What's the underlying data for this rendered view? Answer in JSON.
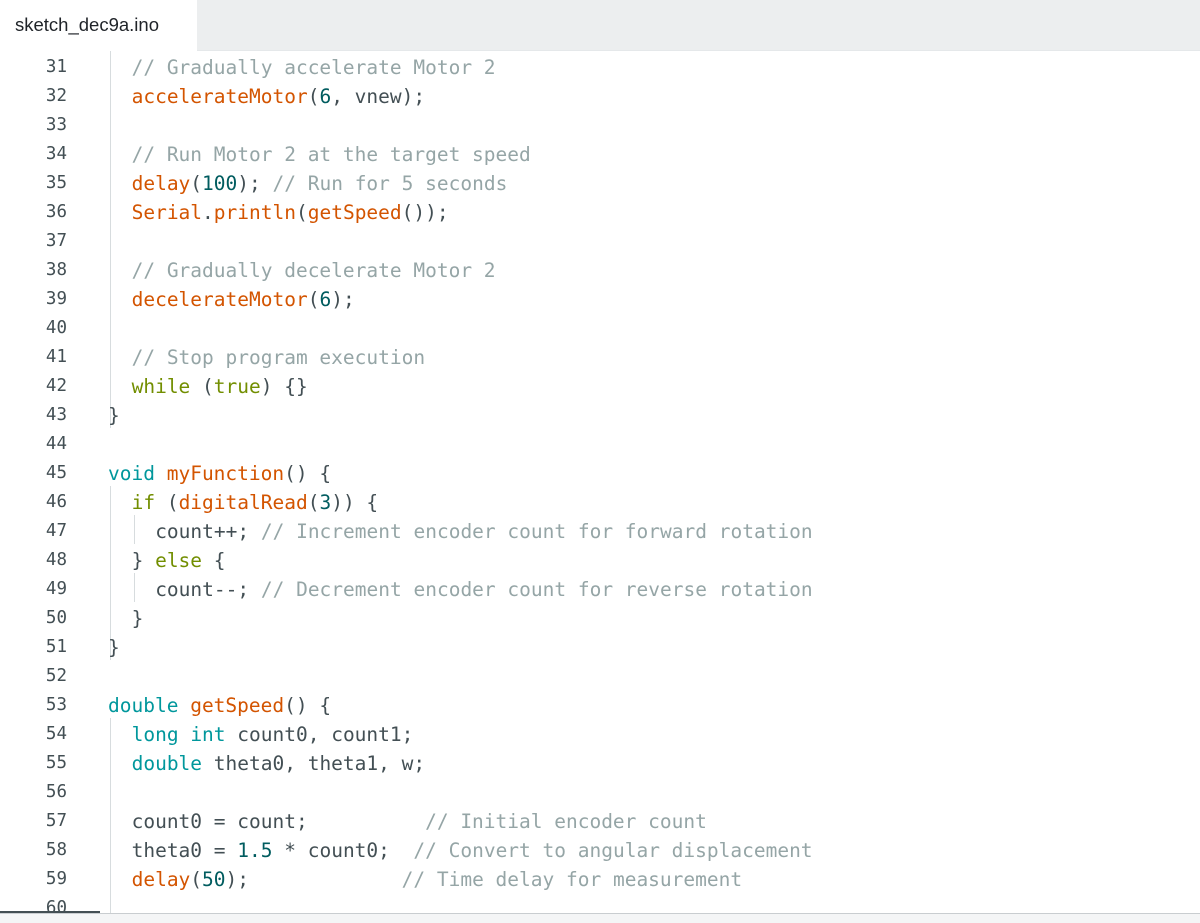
{
  "tab": {
    "file_name": "sketch_dec9a.ino"
  },
  "editor": {
    "lines": [
      {
        "no": "31",
        "indent": 1,
        "tokens": [
          {
            "t": "// Gradually accelerate Motor 2",
            "c": "cm"
          }
        ]
      },
      {
        "no": "32",
        "indent": 1,
        "tokens": [
          {
            "t": "accelerateMotor",
            "c": "fn"
          },
          {
            "t": "(",
            "c": "pl"
          },
          {
            "t": "6",
            "c": "nm"
          },
          {
            "t": ", vnew);",
            "c": "pl"
          }
        ]
      },
      {
        "no": "33",
        "indent": 0,
        "tokens": []
      },
      {
        "no": "34",
        "indent": 1,
        "tokens": [
          {
            "t": "// Run Motor 2 at the target speed",
            "c": "cm"
          }
        ]
      },
      {
        "no": "35",
        "indent": 1,
        "tokens": [
          {
            "t": "delay",
            "c": "fn"
          },
          {
            "t": "(",
            "c": "pl"
          },
          {
            "t": "100",
            "c": "nm"
          },
          {
            "t": "); ",
            "c": "pl"
          },
          {
            "t": "// Run for 5 seconds",
            "c": "cm"
          }
        ]
      },
      {
        "no": "36",
        "indent": 1,
        "tokens": [
          {
            "t": "Serial",
            "c": "fn"
          },
          {
            "t": ".",
            "c": "pl"
          },
          {
            "t": "println",
            "c": "fn"
          },
          {
            "t": "(",
            "c": "pl"
          },
          {
            "t": "getSpeed",
            "c": "fn"
          },
          {
            "t": "());",
            "c": "pl"
          }
        ]
      },
      {
        "no": "37",
        "indent": 0,
        "tokens": []
      },
      {
        "no": "38",
        "indent": 1,
        "tokens": [
          {
            "t": "// Gradually decelerate Motor 2",
            "c": "cm"
          }
        ]
      },
      {
        "no": "39",
        "indent": 1,
        "tokens": [
          {
            "t": "decelerateMotor",
            "c": "fn"
          },
          {
            "t": "(",
            "c": "pl"
          },
          {
            "t": "6",
            "c": "nm"
          },
          {
            "t": ");",
            "c": "pl"
          }
        ]
      },
      {
        "no": "40",
        "indent": 0,
        "tokens": []
      },
      {
        "no": "41",
        "indent": 1,
        "tokens": [
          {
            "t": "// Stop program execution",
            "c": "cm"
          }
        ]
      },
      {
        "no": "42",
        "indent": 1,
        "tokens": [
          {
            "t": "while",
            "c": "kw"
          },
          {
            "t": " (",
            "c": "pl"
          },
          {
            "t": "true",
            "c": "kw"
          },
          {
            "t": ") {}",
            "c": "pl"
          }
        ]
      },
      {
        "no": "43",
        "indent": 0,
        "tokens": [
          {
            "t": "}",
            "c": "pl"
          }
        ]
      },
      {
        "no": "44",
        "indent": 0,
        "tokens": []
      },
      {
        "no": "45",
        "indent": 0,
        "tokens": [
          {
            "t": "void",
            "c": "ty"
          },
          {
            "t": " ",
            "c": "pl"
          },
          {
            "t": "myFunction",
            "c": "fn"
          },
          {
            "t": "() {",
            "c": "pl"
          }
        ]
      },
      {
        "no": "46",
        "indent": 1,
        "tokens": [
          {
            "t": "if",
            "c": "kw"
          },
          {
            "t": " (",
            "c": "pl"
          },
          {
            "t": "digitalRead",
            "c": "fn"
          },
          {
            "t": "(",
            "c": "pl"
          },
          {
            "t": "3",
            "c": "nm"
          },
          {
            "t": ")) {",
            "c": "pl"
          }
        ]
      },
      {
        "no": "47",
        "indent": 2,
        "tokens": [
          {
            "t": "count++; ",
            "c": "pl"
          },
          {
            "t": "// Increment encoder count for forward rotation",
            "c": "cm"
          }
        ]
      },
      {
        "no": "48",
        "indent": 1,
        "tokens": [
          {
            "t": "} ",
            "c": "pl"
          },
          {
            "t": "else",
            "c": "kw"
          },
          {
            "t": " {",
            "c": "pl"
          }
        ]
      },
      {
        "no": "49",
        "indent": 2,
        "tokens": [
          {
            "t": "count--; ",
            "c": "pl"
          },
          {
            "t": "// Decrement encoder count for reverse rotation",
            "c": "cm"
          }
        ]
      },
      {
        "no": "50",
        "indent": 1,
        "tokens": [
          {
            "t": "}",
            "c": "pl"
          }
        ]
      },
      {
        "no": "51",
        "indent": 0,
        "tokens": [
          {
            "t": "}",
            "c": "pl"
          }
        ]
      },
      {
        "no": "52",
        "indent": 0,
        "tokens": []
      },
      {
        "no": "53",
        "indent": 0,
        "tokens": [
          {
            "t": "double",
            "c": "ty"
          },
          {
            "t": " ",
            "c": "pl"
          },
          {
            "t": "getSpeed",
            "c": "fn"
          },
          {
            "t": "() {",
            "c": "pl"
          }
        ]
      },
      {
        "no": "54",
        "indent": 1,
        "tokens": [
          {
            "t": "long",
            "c": "ty"
          },
          {
            "t": " ",
            "c": "pl"
          },
          {
            "t": "int",
            "c": "ty"
          },
          {
            "t": " count0, count1;",
            "c": "pl"
          }
        ]
      },
      {
        "no": "55",
        "indent": 1,
        "tokens": [
          {
            "t": "double",
            "c": "ty"
          },
          {
            "t": " theta0, theta1, w;",
            "c": "pl"
          }
        ]
      },
      {
        "no": "56",
        "indent": 0,
        "tokens": []
      },
      {
        "no": "57",
        "indent": 1,
        "tokens": [
          {
            "t": "count0 = count;          ",
            "c": "pl"
          },
          {
            "t": "// Initial encoder count",
            "c": "cm"
          }
        ]
      },
      {
        "no": "58",
        "indent": 1,
        "tokens": [
          {
            "t": "theta0 = ",
            "c": "pl"
          },
          {
            "t": "1.5",
            "c": "nm"
          },
          {
            "t": " * count0;  ",
            "c": "pl"
          },
          {
            "t": "// Convert to angular displacement",
            "c": "cm"
          }
        ]
      },
      {
        "no": "59",
        "indent": 1,
        "tokens": [
          {
            "t": "delay",
            "c": "fn"
          },
          {
            "t": "(",
            "c": "pl"
          },
          {
            "t": "50",
            "c": "nm"
          },
          {
            "t": ");             ",
            "c": "pl"
          },
          {
            "t": "// Time delay for measurement",
            "c": "cm"
          }
        ]
      },
      {
        "no": "60",
        "indent": 0,
        "tokens": []
      }
    ]
  },
  "colors": {
    "comment": "#95a5a6",
    "function": "#d35400",
    "keyword": "#728e00",
    "type": "#00979c",
    "number": "#005c5f",
    "plain": "#434f54"
  }
}
